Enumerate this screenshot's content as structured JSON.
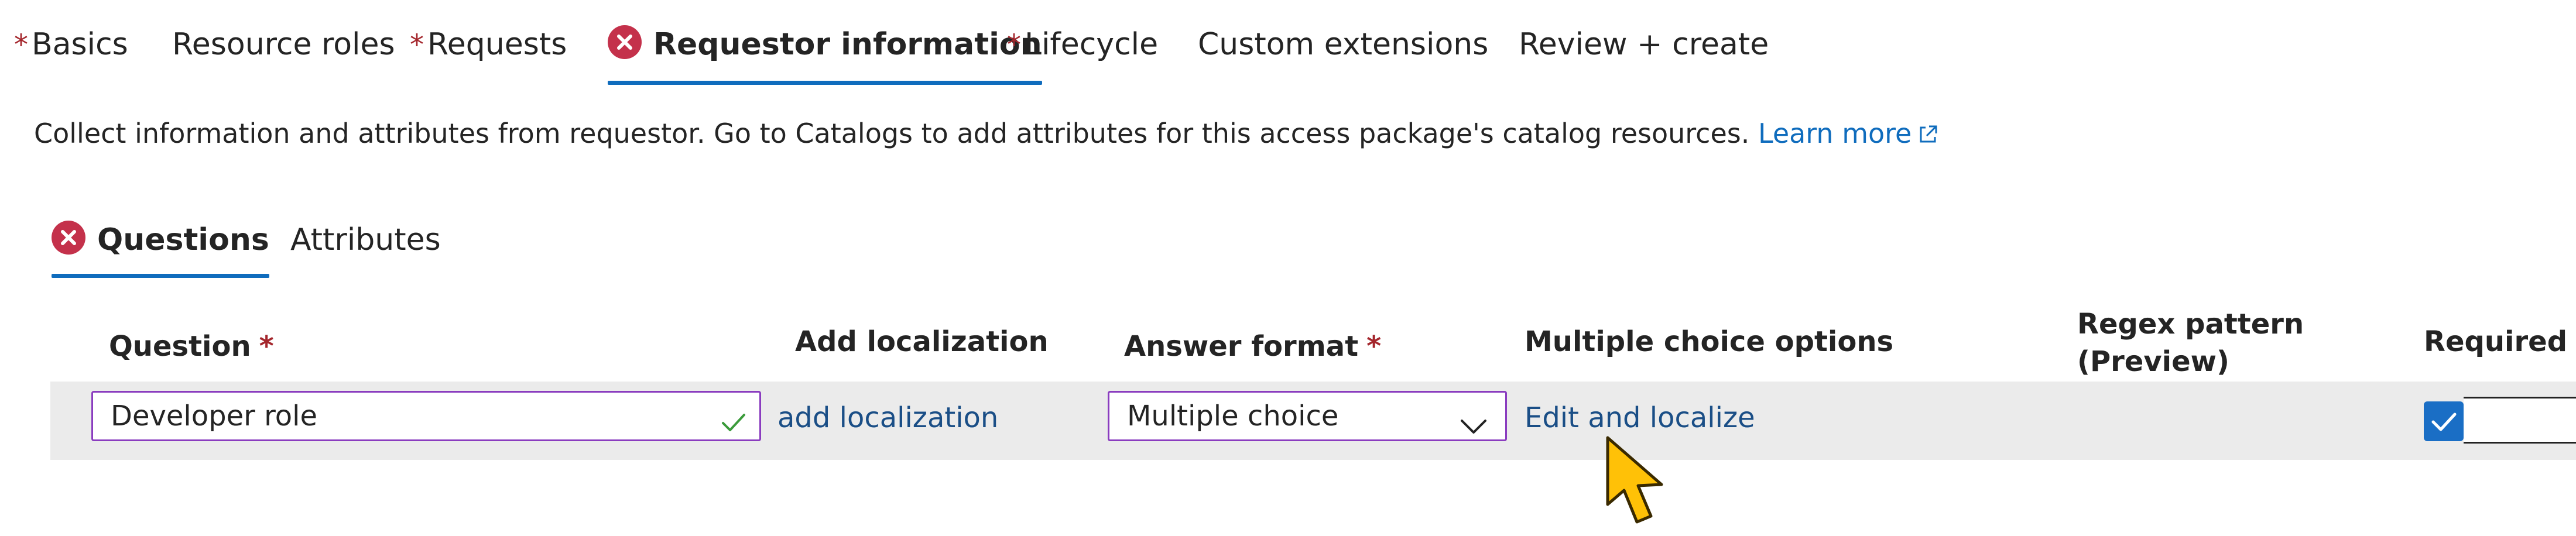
{
  "wizard_tabs": [
    {
      "label": "Basics",
      "required": true,
      "error": false,
      "active": false
    },
    {
      "label": "Resource roles",
      "required": false,
      "error": false,
      "active": false
    },
    {
      "label": "Requests",
      "required": true,
      "error": false,
      "active": false
    },
    {
      "label": "Requestor information",
      "required": false,
      "error": true,
      "active": true
    },
    {
      "label": "Lifecycle",
      "required": true,
      "error": false,
      "active": false
    },
    {
      "label": "Custom extensions",
      "required": false,
      "error": false,
      "active": false
    },
    {
      "label": "Review + create",
      "required": false,
      "error": false,
      "active": false
    }
  ],
  "required_marker": "*",
  "description": {
    "text": "Collect information and attributes from requestor. Go to Catalogs to add attributes for this access package's catalog resources.",
    "link": "Learn more",
    "link_icon": "external-link-icon"
  },
  "sub_tabs": [
    {
      "label": "Questions",
      "error": true,
      "active": true
    },
    {
      "label": "Attributes",
      "error": false,
      "active": false
    }
  ],
  "columns": {
    "question": "Question",
    "localization": "Add localization",
    "answer_format": "Answer format",
    "multiple_choice": "Multiple choice options",
    "regex_line1": "Regex pattern",
    "regex_line2": "(Preview)",
    "required": "Required"
  },
  "row": {
    "question_value": "Developer role",
    "question_valid_icon": "checkmark-icon",
    "localization_link": "add localization",
    "answer_format_value": "Multiple choice",
    "multiple_choice_link": "Edit and localize",
    "required_checked": true
  },
  "colors": {
    "accent": "#0f6cbd",
    "link": "#1a4e86",
    "error": "#c4314b",
    "required_star": "#a4262c",
    "field_border": "#8a3cbf",
    "row_background": "#ebebeb",
    "cursor": "#ffc107"
  }
}
